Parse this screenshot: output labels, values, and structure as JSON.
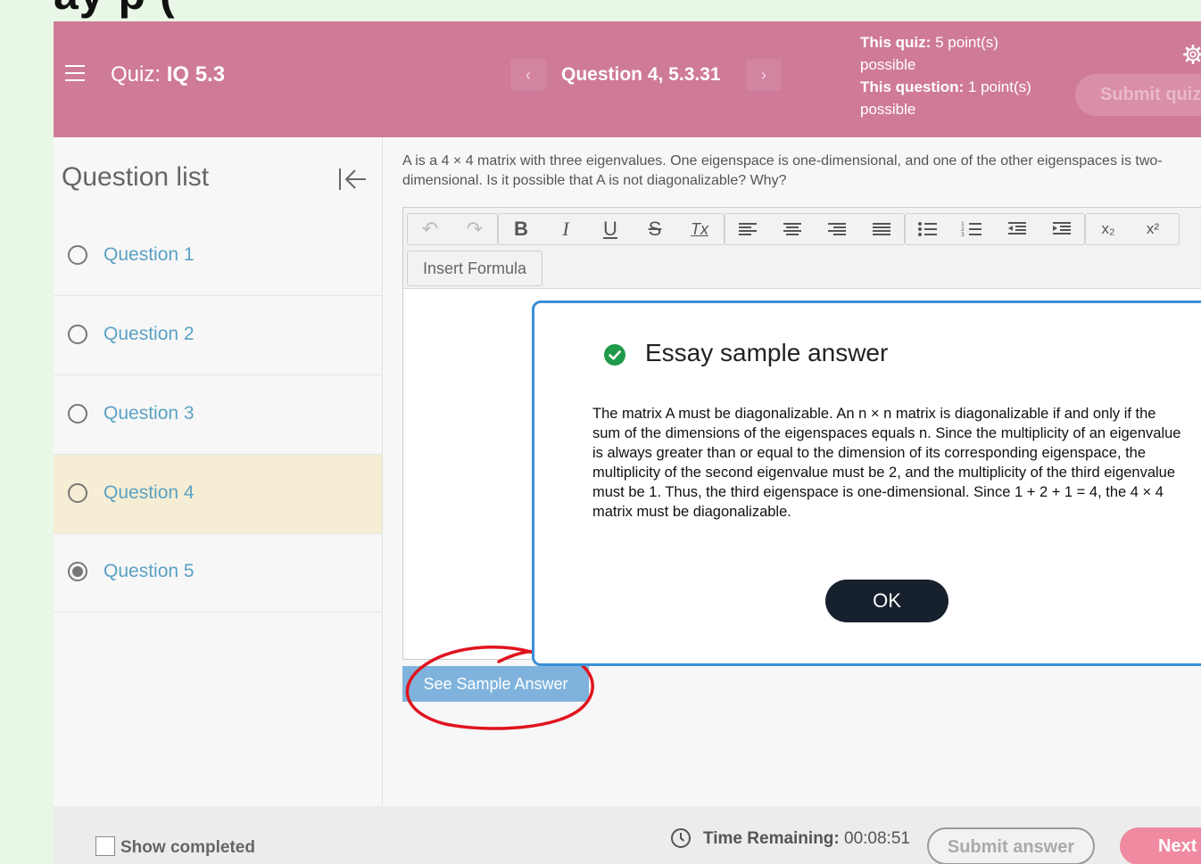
{
  "top_cut_text": "ay p     (",
  "header": {
    "quiz_label": "Quiz:",
    "quiz_name": "IQ 5.3",
    "prev_arrow": "‹",
    "next_arrow": "›",
    "question_title": "Question 4, 5.3.31",
    "this_quiz_label": "This quiz:",
    "this_quiz_value": "5 point(s) possible",
    "this_question_label": "This question:",
    "this_question_value": "1 point(s) possible",
    "submit_quiz": "Submit quiz"
  },
  "sidebar": {
    "title": "Question list",
    "items": [
      {
        "label": "Question 1",
        "state": "empty"
      },
      {
        "label": "Question 2",
        "state": "empty"
      },
      {
        "label": "Question 3",
        "state": "empty"
      },
      {
        "label": "Question 4",
        "state": "current"
      },
      {
        "label": "Question 5",
        "state": "answered"
      }
    ]
  },
  "main": {
    "question_text": "A is a 4 × 4 matrix with three eigenvalues. One eigenspace is one-dimensional, and one of the other eigenspaces is two-dimensional. Is it possible that A is not diagonalizable? Why?",
    "toolbar": {
      "undo": "↶",
      "redo": "↷",
      "bold": "B",
      "italic": "I",
      "underline": "U",
      "strike": "S",
      "clear_format": "Tx",
      "subscript": "x₂",
      "superscript": "x²",
      "insert_formula": "Insert Formula"
    },
    "see_sample_answer": "See Sample Answer"
  },
  "modal": {
    "title": "Essay sample answer",
    "body": "The matrix A must be diagonalizable. An n × n matrix is diagonalizable if and only if the sum of the dimensions of the eigenspaces equals n. Since the multiplicity of an eigenvalue is always greater than or equal to the dimension of its corresponding eigenspace, the multiplicity of the second eigenvalue must be 2, and the multiplicity of the third eigenvalue must be 1. Thus, the third eigenspace is one-dimensional. Since 1 + 2 + 1 = 4, the 4 × 4 matrix must be diagonalizable.",
    "ok": "OK"
  },
  "footer": {
    "show_completed": "Show completed",
    "time_label": "Time Remaining:",
    "time_value": "00:08:51",
    "submit_answer": "Submit answer",
    "next": "Next"
  },
  "colors": {
    "header_bg": "#cf7a99",
    "link_blue": "#5aa1c4",
    "modal_border": "#3a8fd6",
    "ok_button": "#17202d",
    "check_green": "#1f9a4a",
    "annotation_red": "#e0141e"
  }
}
